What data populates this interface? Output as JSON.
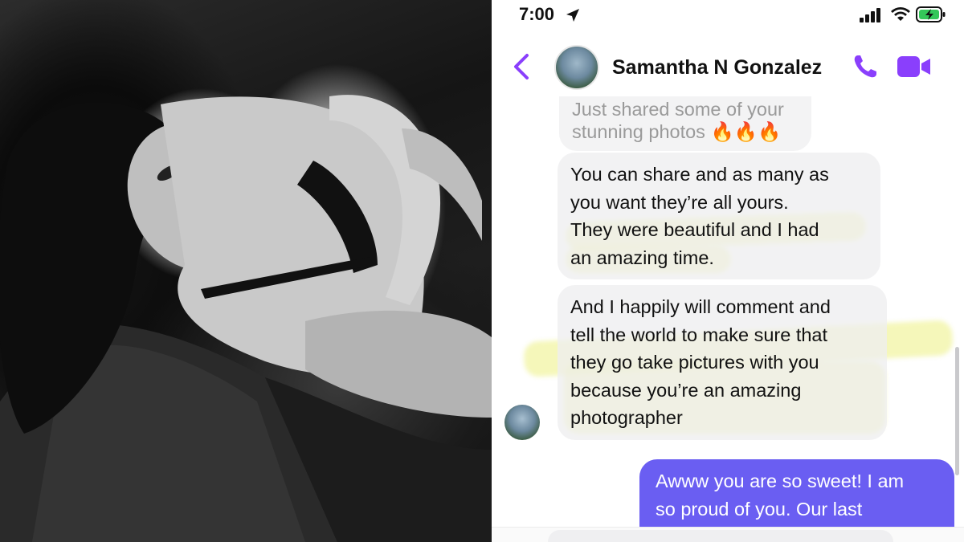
{
  "status_bar": {
    "time": "7:00"
  },
  "header": {
    "contact_name": "Samantha N Gonzalez"
  },
  "messages": [
    {
      "direction": "in",
      "lines": [
        "Just shared some of your",
        "stunning photos 🔥🔥🔥"
      ],
      "faded": true
    },
    {
      "direction": "in",
      "lines": [
        "You can share and as many as",
        "you want they’re all yours.",
        "They were beautiful and I had",
        "an amazing time."
      ],
      "highlighted": true
    },
    {
      "direction": "in",
      "lines": [
        "And I happily will comment and",
        "tell the world to make sure that",
        "they go take pictures with you",
        "because you’re an amazing",
        "photographer"
      ],
      "highlighted": true
    },
    {
      "direction": "out",
      "lines": [
        "Awww you are so sweet! I am",
        "so proud of you. Our last"
      ]
    }
  ],
  "colors": {
    "accent": "#8a3ffc",
    "outgoing_bubble": "#6a5ef2",
    "incoming_bubble": "#eeeeef",
    "highlight": "#ecf082",
    "battery_fill": "#34c759"
  },
  "icons": {
    "back": "chevron-left-icon",
    "call": "phone-icon",
    "video": "video-camera-icon",
    "location": "location-arrow-icon",
    "signal": "cellular-signal-icon",
    "wifi": "wifi-icon",
    "battery": "battery-charging-icon"
  }
}
